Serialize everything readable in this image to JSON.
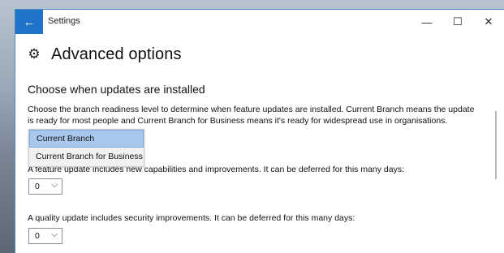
{
  "window": {
    "title": "Settings",
    "back_icon": "←",
    "minimize_icon": "—",
    "maximize_icon": "☐",
    "close_icon": "✕"
  },
  "page": {
    "title": "Advanced options",
    "gear_icon": "⚙"
  },
  "section": {
    "heading": "Choose when updates are installed",
    "description": "Choose the branch readiness level to determine when feature updates are installed. Current Branch means the update is ready for most people and Current Branch for Business means it's ready for widespread use in organisations."
  },
  "branch_dropdown": {
    "options": [
      "Current Branch",
      "Current Branch for Business"
    ],
    "selected": "Current Branch"
  },
  "feature_update": {
    "label": "A feature update includes new capabilities and improvements. It can be deferred for this many days:",
    "value": "0",
    "chevron": "⌵"
  },
  "quality_update": {
    "label": "A quality update includes security improvements. It can be deferred for this many days:",
    "value": "0",
    "chevron": "⌵"
  }
}
